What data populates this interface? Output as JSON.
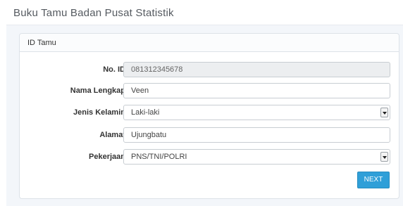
{
  "header": {
    "title": "Buku Tamu Badan Pusat Statistik"
  },
  "panel": {
    "heading": "ID Tamu"
  },
  "form": {
    "no_id": {
      "label": "No. ID",
      "value": "081312345678"
    },
    "nama": {
      "label": "Nama Lengkap",
      "value": "Veen"
    },
    "jenis_kelamin": {
      "label": "Jenis Kelamin",
      "value": "Laki-laki"
    },
    "alamat": {
      "label": "Alamat",
      "value": "Ujungbatu"
    },
    "pekerjaan": {
      "label": "Pekerjaan",
      "value": "PNS/TNI/POLRI"
    }
  },
  "actions": {
    "next_label": "NEXT"
  },
  "colors": {
    "accent": "#2f9fd8"
  }
}
